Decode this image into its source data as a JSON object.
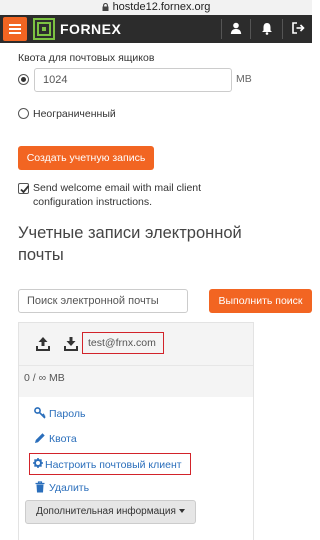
{
  "browser": {
    "url": "hostde12.fornex.org"
  },
  "header": {
    "brand": "FORNEX"
  },
  "quota": {
    "label": "Квота для почтовых ящиков",
    "value": "1024",
    "unit": "MB",
    "unlimited_label": "Неограниченный"
  },
  "create_button": "Создать учетную запись",
  "welcome_email": {
    "checked": true,
    "label_line1": "Send welcome email with mail client",
    "label_line2": "configuration instructions."
  },
  "accounts": {
    "heading_line1": "Учетные записи электронной",
    "heading_line2": "почты",
    "search_placeholder": "Поиск электронной почты",
    "search_button": "Выполнить поиск"
  },
  "account": {
    "email": "test@frnx.com",
    "usage": "0 / ∞ MB",
    "actions": {
      "password": "Пароль",
      "quota": "Квота",
      "configure_client": "Настроить почтовый клиент",
      "delete": "Удалить"
    },
    "more_button": "Дополнительная информация"
  },
  "colors": {
    "accent": "#f26522",
    "header_bg": "#2c2c2c",
    "link": "#2a6ebb",
    "highlight": "#d2232a"
  }
}
